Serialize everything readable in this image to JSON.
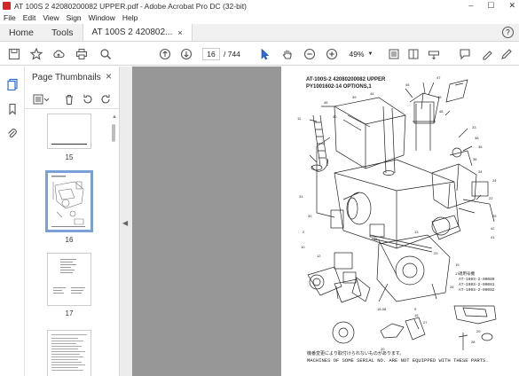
{
  "window": {
    "title": "AT 100S 2 42080200082 UPPER.pdf - Adobe Acrobat Pro DC (32-bit)",
    "controls": [
      "–",
      "☐",
      "✕"
    ]
  },
  "menu": [
    "File",
    "Edit",
    "View",
    "Sign",
    "Window",
    "Help"
  ],
  "tabs": {
    "home": "Home",
    "tools": "Tools",
    "document": "AT 100S 2 420802...",
    "close": "×",
    "help": "?"
  },
  "toolbar": {
    "page_current": "16",
    "page_total": "/ 744",
    "zoom": "49%"
  },
  "thumbnails": {
    "title": "Page Thumbnails",
    "close": "×",
    "pages": [
      {
        "num": "15"
      },
      {
        "num": "16",
        "selected": true
      },
      {
        "num": "17"
      }
    ]
  },
  "page": {
    "title_line1": "AT-100S-2 42080200082 UPPER",
    "title_line2": "PY1001602-14 OPTIONS,1",
    "serials": [
      "AT-100S-2-00080",
      "AT-100S-2-00081",
      "AT-100S-2-00082"
    ],
    "serial_header": "適用号機",
    "footnote_jp": "機番変更により取付けられないものがあります。",
    "footnote_en": "MACHINES OF SOME SERIAL NO. ARE NOT EQUIPPED WITH THESE PARTS."
  },
  "colors": {
    "acrobat_red": "#d4262b",
    "selected_blue": "#2c6fd6",
    "doc_bg": "#979797"
  }
}
